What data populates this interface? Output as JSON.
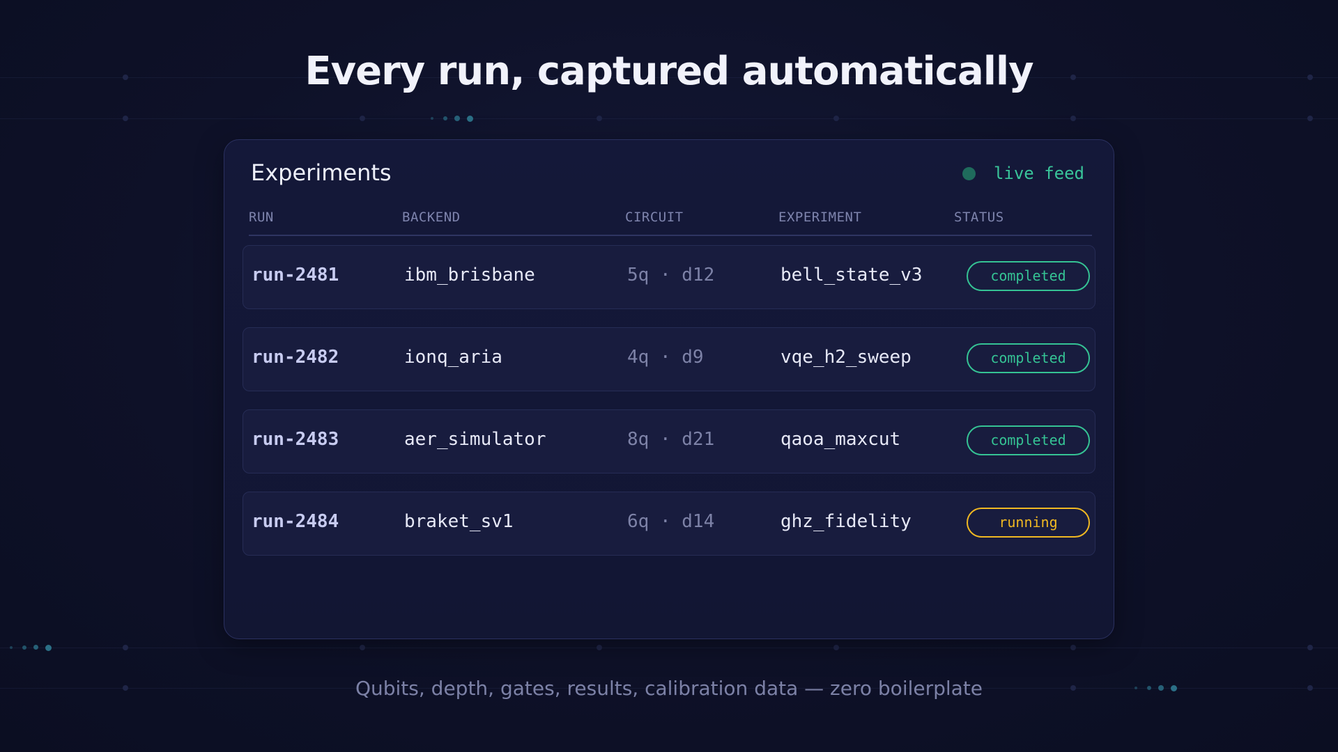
{
  "headline": "Every run, captured automatically",
  "subline": "Qubits, depth, gates, results, calibration data — zero boilerplate",
  "panel": {
    "title": "Experiments",
    "live_label": "live feed",
    "columns": [
      "RUN",
      "BACKEND",
      "CIRCUIT",
      "EXPERIMENT",
      "STATUS"
    ],
    "rows": [
      {
        "run": "run-2481",
        "backend": "ibm_brisbane",
        "circuit": "5q · d12",
        "experiment": "bell_state_v3",
        "status": "completed"
      },
      {
        "run": "run-2482",
        "backend": "ionq_aria",
        "circuit": "4q · d9",
        "experiment": "vqe_h2_sweep",
        "status": "completed"
      },
      {
        "run": "run-2483",
        "backend": "aer_simulator",
        "circuit": "8q · d21",
        "experiment": "qaoa_maxcut",
        "status": "completed"
      },
      {
        "run": "run-2484",
        "backend": "braket_sv1",
        "circuit": "6q · d14",
        "experiment": "ghz_fidelity",
        "status": "running"
      }
    ]
  },
  "colors": {
    "background": "#0e1128",
    "panel": "#141839",
    "completed": "#35c394",
    "running": "#f0b822",
    "live_dot": "#1f6b5c",
    "live_text": "#39c59a"
  }
}
